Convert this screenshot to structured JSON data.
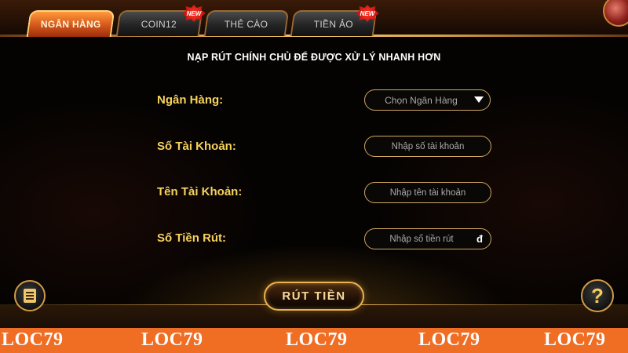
{
  "tabs": [
    {
      "label": "NGÂN HÀNG",
      "active": true
    },
    {
      "label": "COIN12",
      "badge": "NEW"
    },
    {
      "label": "THẺ CÀO"
    },
    {
      "label": "TIỀN ẢO",
      "badge": "NEW"
    }
  ],
  "headline": "NẠP RÚT CHÍNH CHỦ ĐỂ ĐƯỢC XỬ LÝ NHANH HƠN",
  "form": {
    "bank": {
      "label": "Ngân Hàng:",
      "placeholder": "Chọn Ngân Hàng"
    },
    "account_number": {
      "label": "Số Tài Khoản:",
      "placeholder": "Nhập số tài  khoản"
    },
    "account_name": {
      "label": "Tên Tài Khoản:",
      "placeholder": "Nhập tên tài khoản"
    },
    "amount": {
      "label": "Số Tiền Rút:",
      "placeholder": "Nhập số tiền rút",
      "currency": "đ"
    }
  },
  "actions": {
    "withdraw_label": "RÚT TIỀN",
    "help_label": "?",
    "history_icon": "list-icon"
  },
  "watermark": [
    "LOC79",
    "LOC79",
    "LOC79",
    "LOC79",
    "LOC79"
  ],
  "colors": {
    "accent_gold": "#f6d25e",
    "active_tab": "#d3561a",
    "watermark_bg": "#f06d24"
  }
}
